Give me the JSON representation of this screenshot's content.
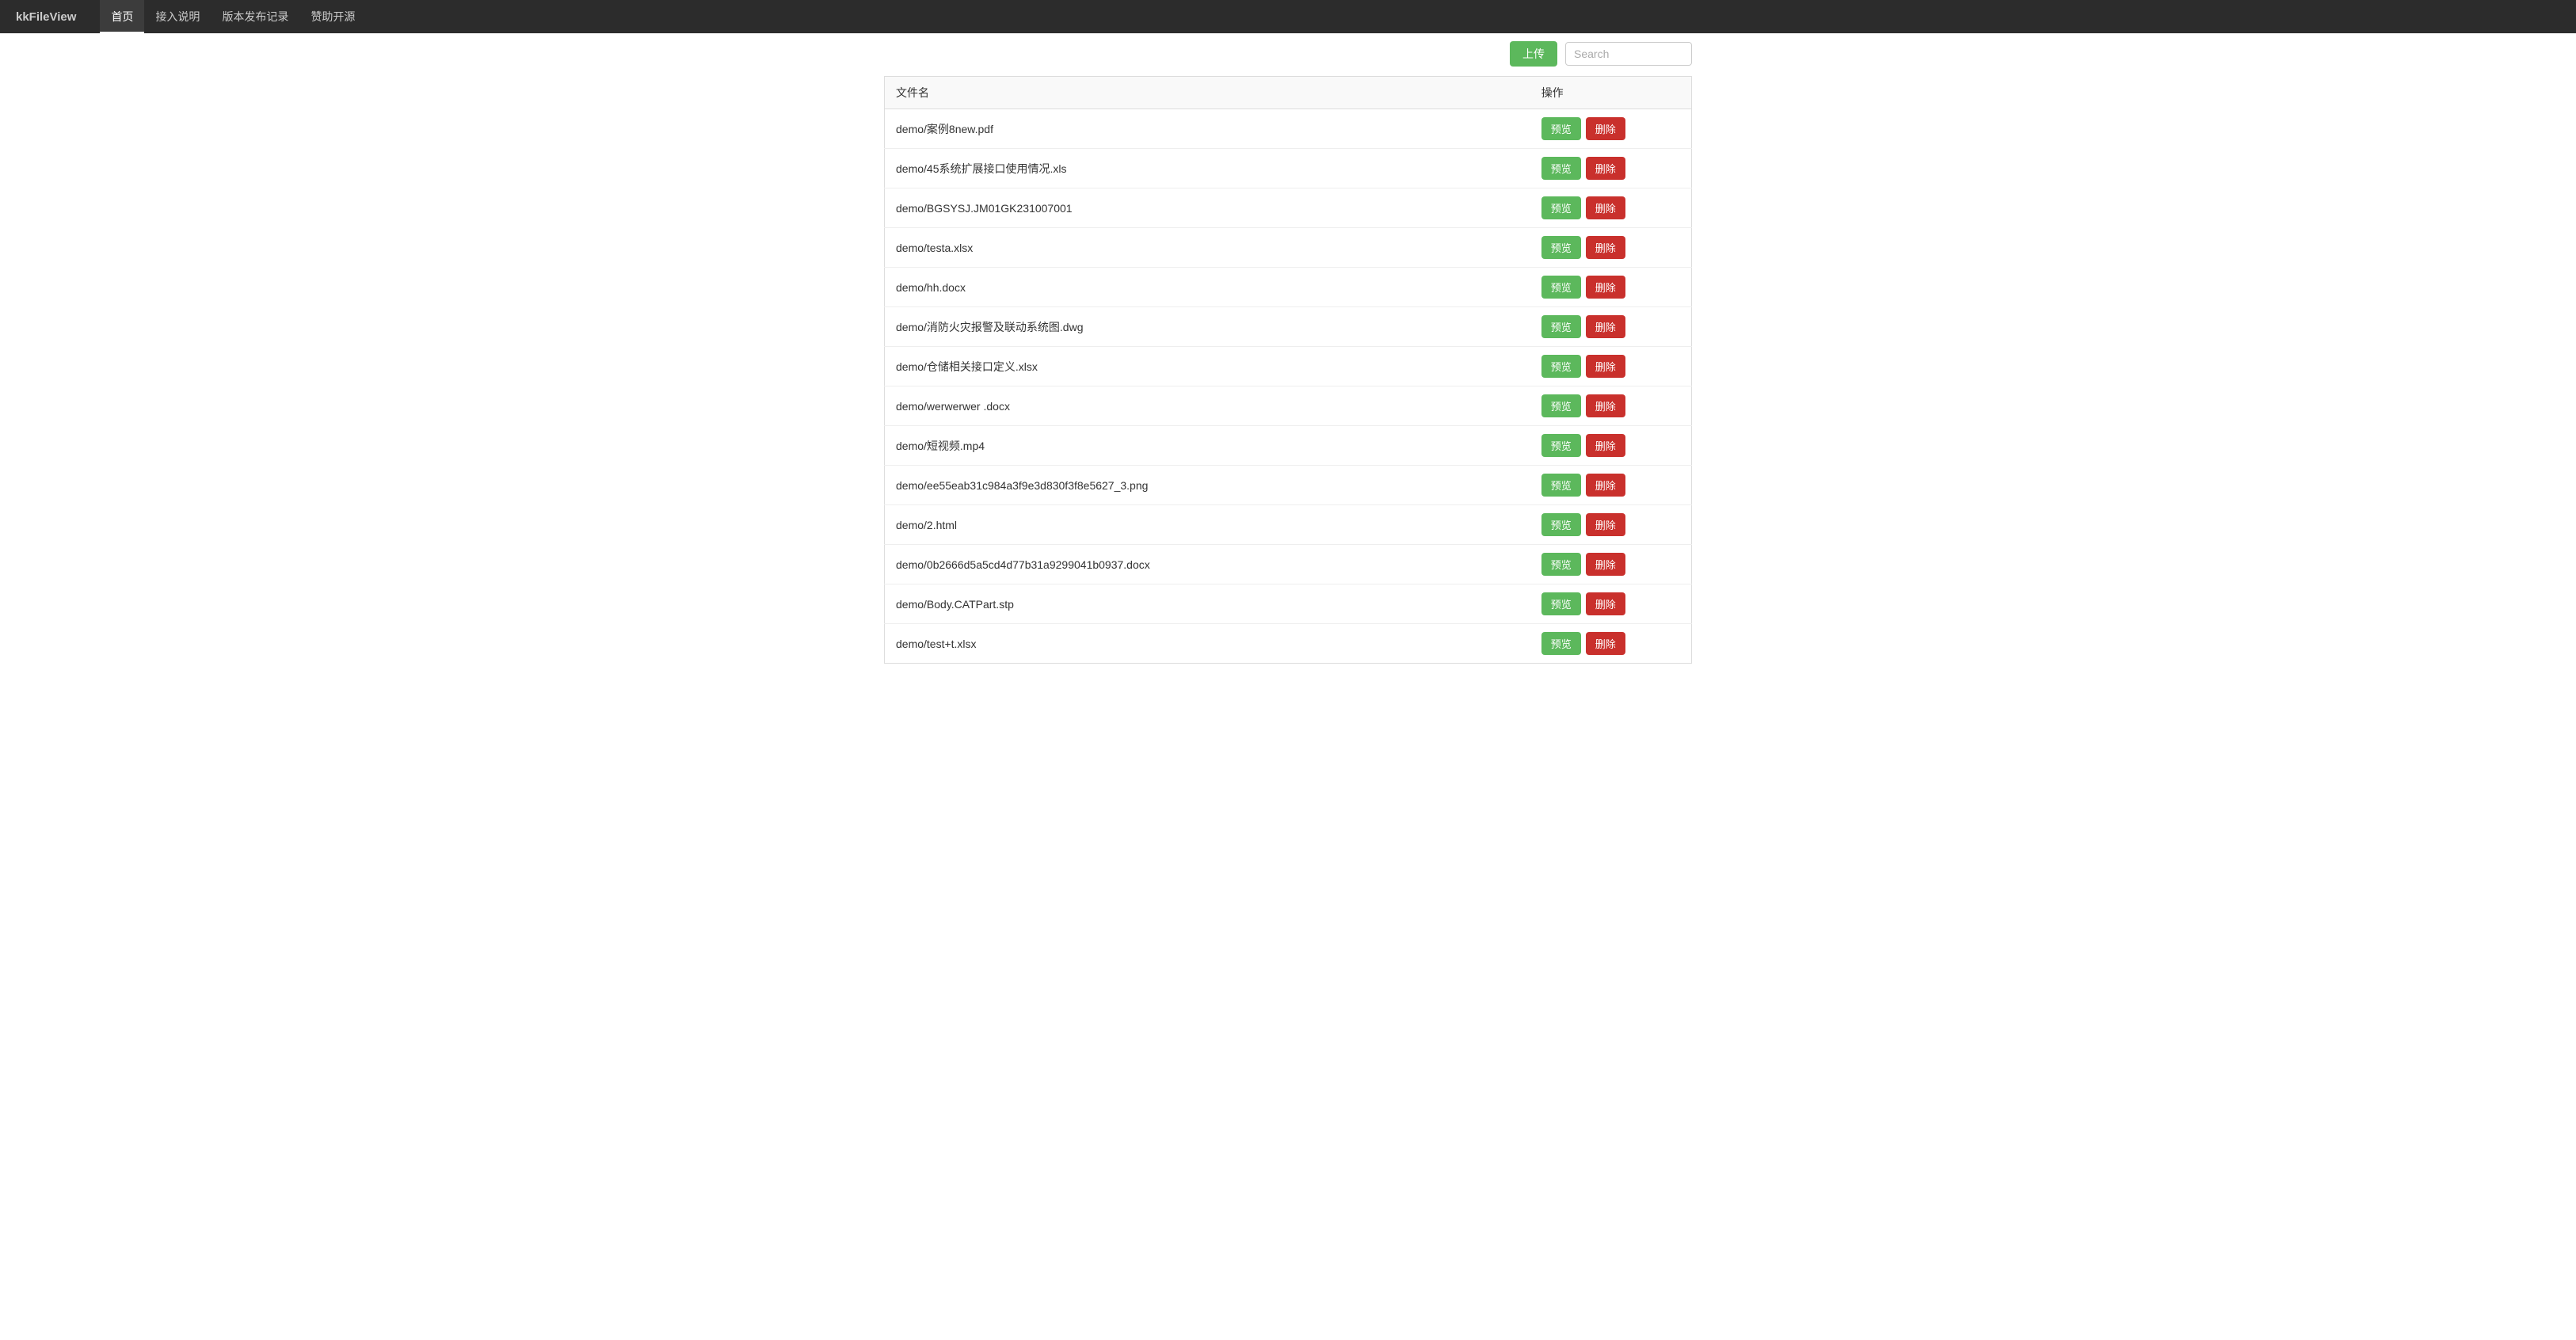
{
  "navbar": {
    "brand": "kkFileView",
    "items": [
      {
        "label": "首页",
        "active": true
      },
      {
        "label": "接入说明",
        "active": false
      },
      {
        "label": "版本发布记录",
        "active": false
      },
      {
        "label": "赞助开源",
        "active": false
      }
    ]
  },
  "topbar": {
    "upload_label": "上传",
    "search_placeholder": "Search"
  },
  "table": {
    "col_name": "文件名",
    "col_action": "操作",
    "preview_label": "预览",
    "delete_label": "删除",
    "rows": [
      {
        "name": "demo/案例8new.pdf"
      },
      {
        "name": "demo/45系统扩展接口使用情况.xls"
      },
      {
        "name": "demo/BGSYSJ.JM01GK231007001"
      },
      {
        "name": "demo/testa.xlsx"
      },
      {
        "name": "demo/hh.docx"
      },
      {
        "name": "demo/消防火灾报警及联动系统图.dwg"
      },
      {
        "name": "demo/仓储相关接口定义.xlsx"
      },
      {
        "name": "demo/werwerwer .docx"
      },
      {
        "name": "demo/短视频.mp4"
      },
      {
        "name": "demo/ee55eab31c984a3f9e3d830f3f8e5627_3.png"
      },
      {
        "name": "demo/2.html"
      },
      {
        "name": "demo/0b2666d5a5cd4d77b31a9299041b0937.docx"
      },
      {
        "name": "demo/Body.CATPart.stp"
      },
      {
        "name": "demo/test+t.xlsx"
      }
    ]
  }
}
